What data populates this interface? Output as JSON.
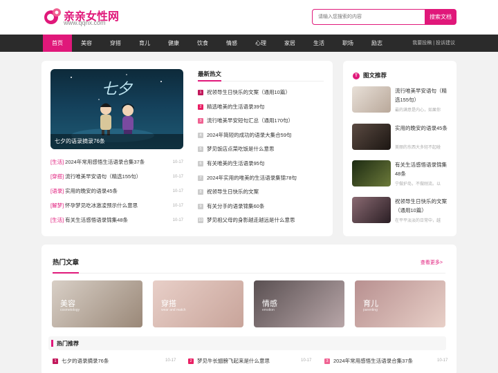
{
  "header": {
    "logo_text": "亲亲女性网",
    "logo_url": "www.qqnx.com",
    "search_placeholder": "请输入您搜索的内容",
    "search_button": "搜索文档"
  },
  "nav": {
    "items": [
      "首页",
      "美容",
      "穿搭",
      "育儿",
      "健康",
      "饮食",
      "情感",
      "心理",
      "家居",
      "生活",
      "职场",
      "励志"
    ],
    "active_index": 0,
    "right_links": [
      "我要投稿",
      "投诉建议"
    ]
  },
  "feature": {
    "caption": "七夕的语录摘录76条",
    "image_title": "七夕"
  },
  "left_list": [
    {
      "tag": "[生活]",
      "title": "2024年常用感悟生活语录合集37条",
      "date": "10-17"
    },
    {
      "tag": "[穿搭]",
      "title": "流行唯美早安语句（精选155句）",
      "date": "10-17"
    },
    {
      "tag": "[语录]",
      "title": "实用的晚安的语录45条",
      "date": "10-17"
    },
    {
      "tag": "[解梦]",
      "title": "怀孕梦见吃冰激凌预示什么意思",
      "date": "10-17"
    },
    {
      "tag": "[生活]",
      "title": "有关生活感悟语录锦集48条",
      "date": "10-17"
    }
  ],
  "latest": {
    "heading": "最新热文",
    "items": [
      {
        "num": "1",
        "title": "祝领导生日快乐的文案（通用10篇）"
      },
      {
        "num": "2",
        "title": "精选唯美的生活语录39句"
      },
      {
        "num": "3",
        "title": "流行唯美早安短句汇总（通用170句）"
      },
      {
        "num": "4",
        "title": "2024年简短的成功的语录大集合59句"
      },
      {
        "num": "5",
        "title": "梦见饭店点菜吃饭是什么意思"
      },
      {
        "num": "6",
        "title": "有关唯美的生活语录95句"
      },
      {
        "num": "7",
        "title": "2024年实用的唯美的生活语录集锦78句"
      },
      {
        "num": "8",
        "title": "祝领导生日快乐的文案"
      },
      {
        "num": "9",
        "title": "有关分手的语录锦集60条"
      },
      {
        "num": "10",
        "title": "梦见祖父母的身影越走越远是什么意思"
      }
    ]
  },
  "pic_rec": {
    "icon_text": "T",
    "heading": "图文推荐",
    "items": [
      {
        "title": "流行唯美早安语句（精选155句）",
        "desc": "最的满意是内心，如果你",
        "color": "#c9b8a8"
      },
      {
        "title": "实用的晚安的语录45条",
        "desc": "美丽的东西大多轻不起碰",
        "color": "#3a2f2a"
      },
      {
        "title": "有关生活感悟语录锦集48条",
        "desc": "宁做护岛，不做刚流。以",
        "color": "#2a3a1e"
      },
      {
        "title": "祝领导生日快乐的文案（通用10篇）",
        "desc": "在平平淡淡的日常中，越",
        "color": "#5a4a52"
      }
    ]
  },
  "hot": {
    "heading": "热门文章",
    "more": "查看更多>",
    "categories": [
      {
        "label": "美容",
        "sub": "cosmetology",
        "color": "#b8a898"
      },
      {
        "label": "穿搭",
        "sub": "wear and match",
        "color": "#d8b8b0"
      },
      {
        "label": "情感",
        "sub": "emotion",
        "color": "#8a7e80"
      },
      {
        "label": "育儿",
        "sub": "parenting",
        "color": "#c8a0a0"
      }
    ]
  },
  "recommend": {
    "heading": "热门推荐",
    "items": [
      {
        "num": "1",
        "title": "七夕的语录摘录76条",
        "date": "10-17"
      },
      {
        "num": "2",
        "title": "梦见牛长翅膀飞起来是什么意思",
        "date": "10-17"
      },
      {
        "num": "3",
        "title": "2024年常用感悟生活语录合集37条",
        "date": "10-17"
      }
    ]
  },
  "colors": {
    "accent": "#e0187a",
    "nav_bg": "#2b2b2b"
  }
}
